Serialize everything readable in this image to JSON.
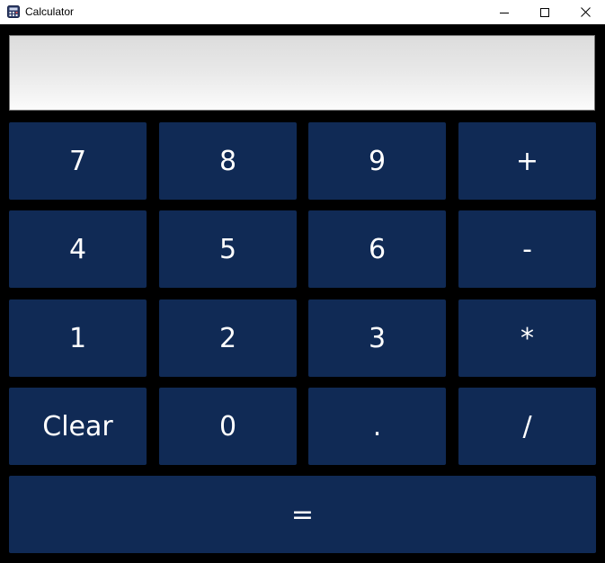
{
  "window": {
    "title": "Calculator",
    "icon": "calculator-app-icon",
    "controls": [
      "minimize-icon",
      "maximize-icon",
      "close-icon"
    ]
  },
  "display": {
    "value": ""
  },
  "keys": {
    "row1": [
      "7",
      "8",
      "9",
      "+"
    ],
    "row2": [
      "4",
      "5",
      "6",
      "-"
    ],
    "row3": [
      "1",
      "2",
      "3",
      "*"
    ],
    "row4": [
      "Clear",
      "0",
      ".",
      "/"
    ],
    "equals": "="
  },
  "colors": {
    "key_background": "#102a55",
    "key_text": "#ffffff",
    "window_background": "#000000"
  }
}
